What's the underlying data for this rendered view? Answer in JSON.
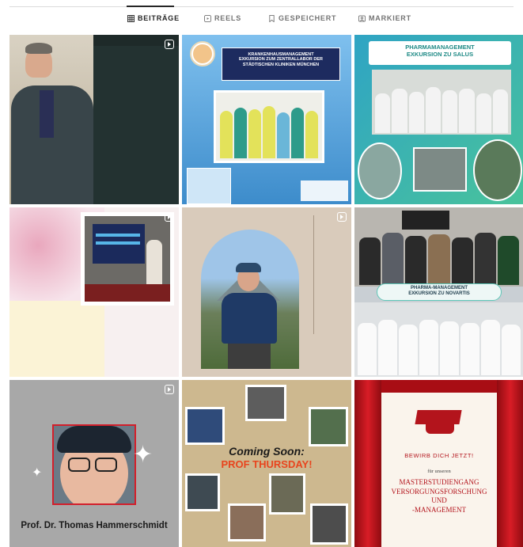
{
  "tabs": [
    {
      "label": "BEITRÄGE",
      "icon": "grid-icon",
      "active": true
    },
    {
      "label": "REELS",
      "icon": "reels-icon",
      "active": false
    },
    {
      "label": "GESPEICHERT",
      "icon": "bookmark-icon",
      "active": false
    },
    {
      "label": "MARKIERT",
      "icon": "tag-icon",
      "active": false
    }
  ],
  "posts": {
    "p2": {
      "line1": "KRANKENHAUSMANAGEMENT",
      "line2": "EXKURSION ZUM ZENTRALLABOR DER",
      "line3": "STÄDTISCHEN KLINIKEN MÜNCHEN"
    },
    "p3": {
      "line1": "PHARMAMANAGEMENT",
      "line2": "EXKURSION ZU SALUS"
    },
    "p6": {
      "line1": "PHARMA-MANAGEMENT",
      "line2": "EXKURSION ZU NOVARTIS"
    },
    "p7": {
      "name": "Prof. Dr. Thomas Hammerschmidt"
    },
    "p8": {
      "line1": "Coming Soon:",
      "line2": "PROF THURSDAY!"
    },
    "p9": {
      "cta": "BEWIRB DICH JETZT!",
      "small": "für unseren",
      "l1": "MASTERSTUDIENGANG",
      "l2": "VERSORGUNGSFORSCHUNG",
      "l3": "UND",
      "l4": "-MANAGEMENT"
    }
  },
  "colors": {
    "accent": "#262626",
    "muted": "#737373",
    "divider": "#dbdbdb",
    "curtain": "#c8131b",
    "prof_thursday": "#e8451e"
  }
}
